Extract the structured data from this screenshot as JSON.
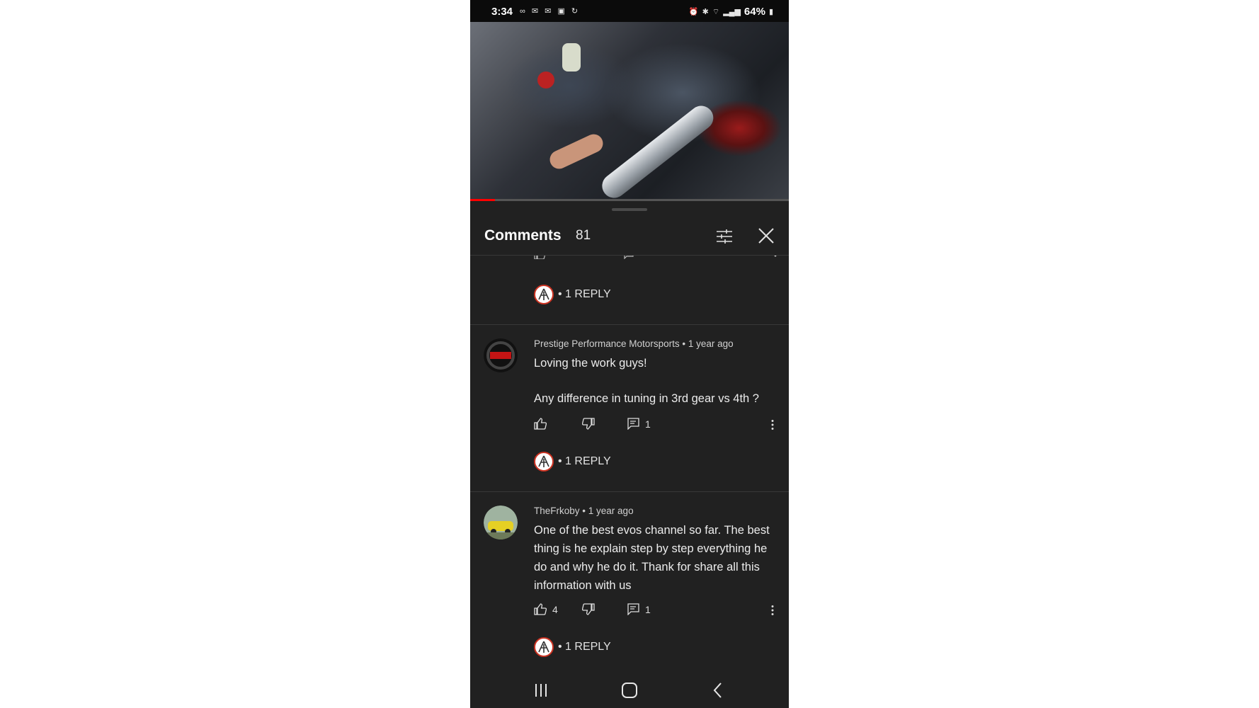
{
  "status_bar": {
    "time": "3:34",
    "battery": "64%"
  },
  "comments_panel": {
    "title": "Comments",
    "count": "81"
  },
  "comments": [
    {
      "author": "Prestige Performance Motorsports",
      "age": "1 year ago",
      "text_line1": "Loving the work guys!",
      "text_line2": "Any difference in tuning in 3rd gear vs 4th ?",
      "likes": "",
      "replies_count": "1",
      "reply_label": "• 1 REPLY"
    },
    {
      "author": "TheFrkoby",
      "age": "1 year ago",
      "text": "One of the best evos channel so far. The best thing is he explain step by step everything he do and why he do it. Thank for share all this information with us",
      "likes": "4",
      "replies_count": "1",
      "reply_label": "• 1 REPLY"
    }
  ],
  "previous_comment": {
    "reply_label": "• 1 REPLY"
  },
  "colors": {
    "sheet_bg": "#212121",
    "divider": "#383838",
    "progress_red": "#ff0000"
  }
}
